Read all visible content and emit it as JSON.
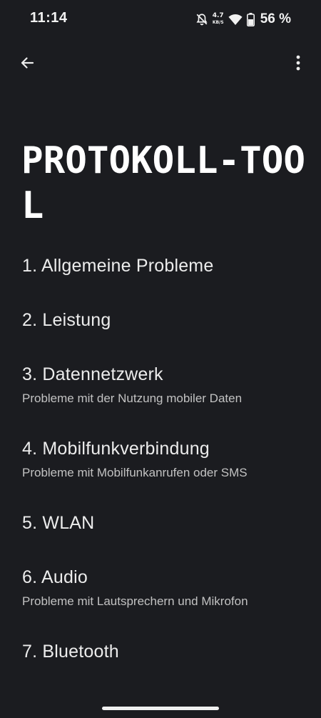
{
  "status_bar": {
    "time": "11:14",
    "net_speed_value": "4.7",
    "net_speed_unit": "KB/S",
    "battery_percent": "56 %",
    "icons": [
      "mute-icon",
      "wifi-icon",
      "battery-icon"
    ]
  },
  "toolbar": {
    "back_icon": "arrow-back-icon",
    "more_icon": "more-vert-icon"
  },
  "page": {
    "title_line1": "PROTOKOLL-TOO",
    "title_line2": "L"
  },
  "menu": {
    "items": [
      {
        "label": "1. Allgemeine Probleme",
        "subtitle": ""
      },
      {
        "label": "2. Leistung",
        "subtitle": ""
      },
      {
        "label": "3. Datennetzwerk",
        "subtitle": "Probleme mit der Nutzung mobiler Daten"
      },
      {
        "label": "4. Mobilfunkverbindung",
        "subtitle": "Probleme mit Mobilfunkanrufen oder SMS"
      },
      {
        "label": "5. WLAN",
        "subtitle": ""
      },
      {
        "label": "6. Audio",
        "subtitle": "Probleme mit Lautsprechern und Mikrofon"
      },
      {
        "label": "7. Bluetooth",
        "subtitle": ""
      }
    ]
  },
  "colors": {
    "background": "#1b1c20",
    "text": "#ececec",
    "subtext": "#c2c2c2"
  }
}
